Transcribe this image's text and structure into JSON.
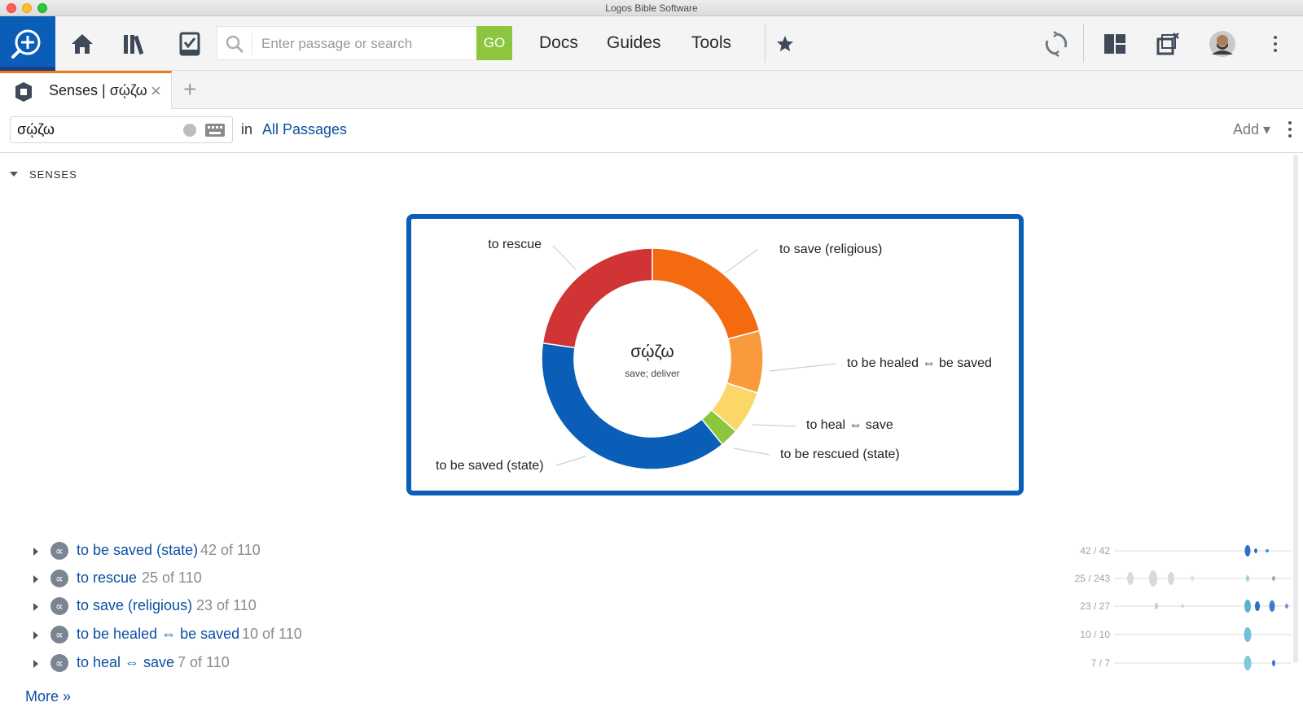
{
  "window": {
    "title": "Logos Bible Software"
  },
  "toolbar": {
    "search_placeholder": "Enter passage or search",
    "go_label": "GO",
    "nav": {
      "docs": "Docs",
      "guides": "Guides",
      "tools": "Tools"
    }
  },
  "tabs": [
    {
      "label": "Senses | σῴζω",
      "close": "×"
    }
  ],
  "new_tab": "+",
  "panel": {
    "query": "σῴζω",
    "in_label": "in",
    "range": "All Passages",
    "add_label": "Add ▾"
  },
  "section": {
    "title": "SENSES"
  },
  "chart_data": {
    "type": "pie",
    "center_title": "σῴζω",
    "center_subtitle": "save; deliver",
    "total": 110,
    "slices": [
      {
        "label": "to save (religious)",
        "value": 23,
        "color": "#f46a10"
      },
      {
        "label": "to be healed ⇔ be saved",
        "value": 10,
        "color": "#f99b3c"
      },
      {
        "label": "to heal ⇔ save",
        "value": 7,
        "color": "#fbd76a"
      },
      {
        "label": "to be rescued (state)",
        "value": 3,
        "color": "#8cc63f"
      },
      {
        "label": "to be saved (state)",
        "value": 42,
        "color": "#0b5eb8"
      },
      {
        "label": "to rescue",
        "value": 25,
        "color": "#d03434"
      }
    ]
  },
  "senses": [
    {
      "label": "to be saved (state)",
      "count": "42 of 110",
      "ratio": "42 / 42"
    },
    {
      "label": "to rescue",
      "count": "25 of 110",
      "ratio": "25 / 243"
    },
    {
      "label": "to save (religious)",
      "count": "23 of 110",
      "ratio": "23 / 27"
    },
    {
      "label": "to be healed ⇔ be saved",
      "count": "10 of 110",
      "ratio": "10 / 10"
    },
    {
      "label": "to heal ⇔ save",
      "count": "7 of 110",
      "ratio": "7 / 7"
    }
  ],
  "sense_icon": "∝",
  "more_label": "More »",
  "icons": {
    "logo": "logos-search-logo-icon",
    "home": "home-icon",
    "library": "library-icon",
    "tasks": "checklist-icon",
    "search": "search-icon",
    "favorites": "star-icon",
    "sync": "sync-icon",
    "layouts": "layouts-icon",
    "detach": "detach-window-icon",
    "user": "avatar",
    "menu": "kebab-menu-icon"
  },
  "colors": {
    "brand_blue": "#0b5eb8",
    "go_green": "#8cc63f",
    "tab_accent": "#f07a14",
    "link_blue": "#0b4fa3"
  }
}
